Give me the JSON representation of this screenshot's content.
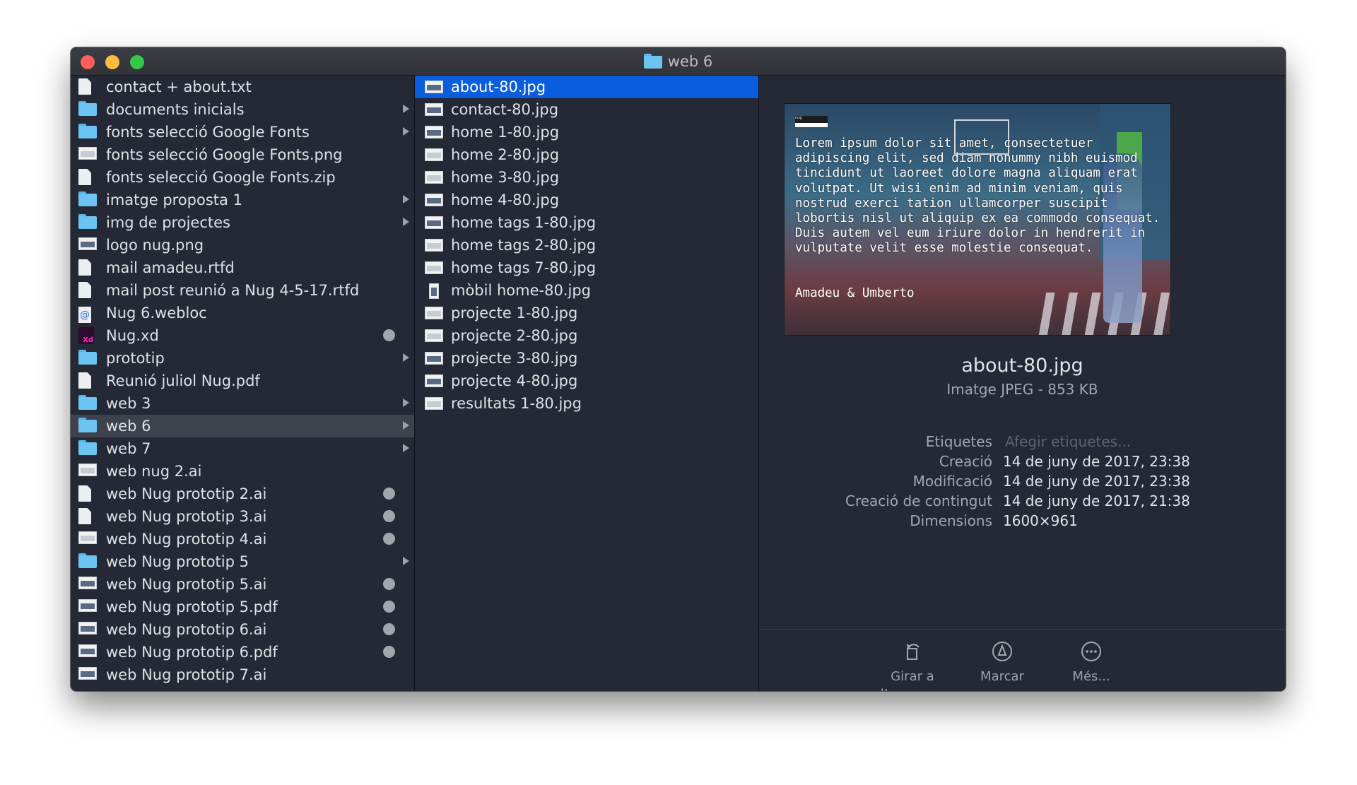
{
  "window": {
    "title": "web 6",
    "title_icon": "folder-icon"
  },
  "column1": {
    "items": [
      {
        "label": "contact + about.txt",
        "icon": "text-doc-icon",
        "arrow": false,
        "tag": false
      },
      {
        "label": "documents inicials",
        "icon": "folder-icon",
        "arrow": true,
        "tag": false
      },
      {
        "label": "fonts selecció Google Fonts",
        "icon": "folder-icon",
        "arrow": true,
        "tag": false
      },
      {
        "label": "fonts selecció Google Fonts.png",
        "icon": "image-icon",
        "arrow": false,
        "tag": false
      },
      {
        "label": "fonts selecció Google Fonts.zip",
        "icon": "zip-icon",
        "arrow": false,
        "tag": false
      },
      {
        "label": "imatge proposta 1",
        "icon": "folder-icon",
        "arrow": true,
        "tag": false
      },
      {
        "label": "img de projectes",
        "icon": "folder-icon",
        "arrow": true,
        "tag": false
      },
      {
        "label": "logo nug.png",
        "icon": "image-icon",
        "arrow": false,
        "tag": false
      },
      {
        "label": "mail amadeu.rtfd",
        "icon": "rtfd-icon",
        "arrow": false,
        "tag": false
      },
      {
        "label": "mail post reunió a Nug 4-5-17.rtfd",
        "icon": "rtfd-icon",
        "arrow": false,
        "tag": false
      },
      {
        "label": "Nug 6.webloc",
        "icon": "webloc-icon",
        "arrow": false,
        "tag": false
      },
      {
        "label": "Nug.xd",
        "icon": "xd-icon",
        "arrow": false,
        "tag": true
      },
      {
        "label": "prototip",
        "icon": "folder-icon",
        "arrow": true,
        "tag": false
      },
      {
        "label": "Reunió juliol Nug.pdf",
        "icon": "pdf-icon",
        "arrow": false,
        "tag": false
      },
      {
        "label": "web 3",
        "icon": "folder-icon",
        "arrow": true,
        "tag": false
      },
      {
        "label": "web 6",
        "icon": "folder-icon",
        "arrow": true,
        "tag": false,
        "selected": true
      },
      {
        "label": "web 7",
        "icon": "folder-icon",
        "arrow": true,
        "tag": false
      },
      {
        "label": "web nug 2.ai",
        "icon": "ai-icon",
        "arrow": false,
        "tag": false
      },
      {
        "label": "web Nug prototip 2.ai",
        "icon": "ai-icon",
        "arrow": false,
        "tag": true
      },
      {
        "label": "web Nug prototip 3.ai",
        "icon": "ai-icon",
        "arrow": false,
        "tag": true
      },
      {
        "label": "web Nug prototip 4.ai",
        "icon": "ai-icon",
        "arrow": false,
        "tag": true
      },
      {
        "label": "web Nug prototip 5",
        "icon": "folder-icon",
        "arrow": true,
        "tag": false
      },
      {
        "label": "web Nug prototip 5.ai",
        "icon": "ai-icon",
        "arrow": false,
        "tag": true
      },
      {
        "label": "web Nug prototip 5.pdf",
        "icon": "pdf-icon",
        "arrow": false,
        "tag": true
      },
      {
        "label": "web Nug prototip 6.ai",
        "icon": "ai-icon",
        "arrow": false,
        "tag": true
      },
      {
        "label": "web Nug prototip 6.pdf",
        "icon": "pdf-icon",
        "arrow": false,
        "tag": true
      },
      {
        "label": "web Nug prototip 7.ai",
        "icon": "ai-icon",
        "arrow": false,
        "tag": false
      }
    ]
  },
  "column2": {
    "items": [
      {
        "label": "about-80.jpg",
        "selected": true
      },
      {
        "label": "contact-80.jpg"
      },
      {
        "label": "home 1-80.jpg"
      },
      {
        "label": "home 2-80.jpg"
      },
      {
        "label": "home 3-80.jpg"
      },
      {
        "label": "home 4-80.jpg"
      },
      {
        "label": "home tags 1-80.jpg"
      },
      {
        "label": "home tags 2-80.jpg"
      },
      {
        "label": "home tags 7-80.jpg"
      },
      {
        "label": "mòbil home-80.jpg"
      },
      {
        "label": "projecte 1-80.jpg"
      },
      {
        "label": "projecte 2-80.jpg"
      },
      {
        "label": "projecte 3-80.jpg"
      },
      {
        "label": "projecte 4-80.jpg"
      },
      {
        "label": "resultats 1-80.jpg"
      }
    ]
  },
  "preview": {
    "image_logo": "nug",
    "image_search": "search",
    "image_text": "Lorem ipsum dolor sit amet, consectetuer adipiscing elit, sed diam nonummy nibh euismod tincidunt ut laoreet dolore magna aliquam erat volutpat. Ut wisi enim ad minim veniam, quis nostrud exerci tation ullamcorper suscipit lobortis nisl ut aliquip ex ea commodo consequat. Duis autem vel eum iriure dolor in hendrerit in vulputate velit esse molestie consequat.",
    "image_signature": "Amadeu & Umberto",
    "file_name": "about-80.jpg",
    "file_kind": "Imatge JPEG - 853 KB",
    "meta": {
      "tags_label": "Etiquetes",
      "tags_placeholder": "Afegir etiquetes...",
      "created_label": "Creació",
      "created_value": "14 de juny de 2017, 23:38",
      "modified_label": "Modificació",
      "modified_value": "14 de juny de 2017, 23:38",
      "content_created_label": "Creació de contingut",
      "content_created_value": "14 de juny de 2017, 21:38",
      "dimensions_label": "Dimensions",
      "dimensions_value": "1600×961"
    },
    "actions": {
      "rotate_left": "Girar a l’esquerra",
      "markup": "Marcar",
      "more": "Més..."
    }
  },
  "colors": {
    "window_bg": "#242935",
    "selection_blue": "#0a5ddc",
    "selection_grey": "#3e424c",
    "folder_blue": "#6cc4f2",
    "tag_dot": "#a2a5ab"
  }
}
